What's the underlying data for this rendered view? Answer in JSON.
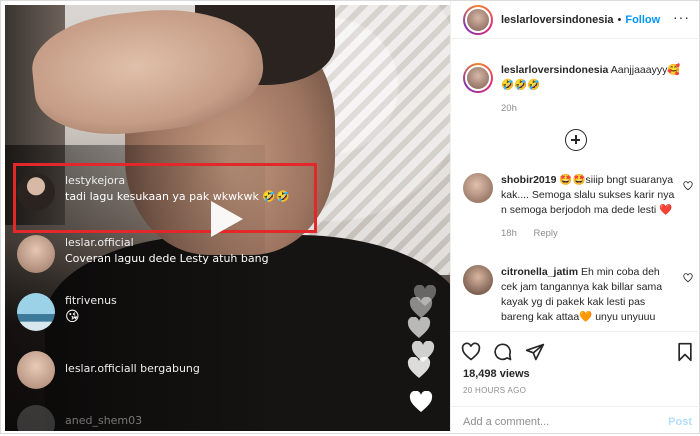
{
  "video": {
    "comments": [
      {
        "user": "lestykejora",
        "text": "tadi lagu kesukaan ya pak wkwkwk 🤣🤣",
        "avatar_color": "#3b2f2b"
      },
      {
        "user": "leslar.official",
        "text": "Coveran laguu dede Lesty atuh bang",
        "avatar_color": "#b8917a"
      },
      {
        "user": "fitrivenus",
        "text": "😘",
        "avatar_color": "#7fc1d9"
      },
      {
        "user": "leslar.officiall bergabung",
        "text": "",
        "avatar_color": "#c4a08a"
      },
      {
        "user": "aned_shem03",
        "text": "",
        "avatar_color": "#6c6c6c"
      }
    ],
    "highlight_color": "#e3282b"
  },
  "header": {
    "username": "leslarloversindonesia",
    "separator": "•",
    "follow_label": "Follow",
    "more_label": "···"
  },
  "caption": {
    "username": "leslarloversindonesia",
    "text": "Aanjjaaayyy🥰🤣🤣🤣",
    "time": "20h"
  },
  "comments": [
    {
      "username": "shobir2019",
      "text": "🤩🤩siiip bngt suaranya kak.... Semoga slalu sukses karir nya n semoga berjodoh ma dede lesti ❤️",
      "time": "18h",
      "reply_label": "Reply"
    },
    {
      "username": "citronella_jatim",
      "text": "Eh min coba deh cek jam tangannya kak billar sama kayak yg di pakek kak lesti pas bareng kak attaa🧡 unyu unyuuu",
      "time": "",
      "reply_label": ""
    }
  ],
  "stats": {
    "views": "18,498 views",
    "posted": "20 HOURS AGO"
  },
  "add_comment": {
    "placeholder": "Add a comment...",
    "post_label": "Post"
  },
  "colors": {
    "follow": "#0095f6",
    "text": "#262626",
    "muted": "#8e8e8e"
  }
}
